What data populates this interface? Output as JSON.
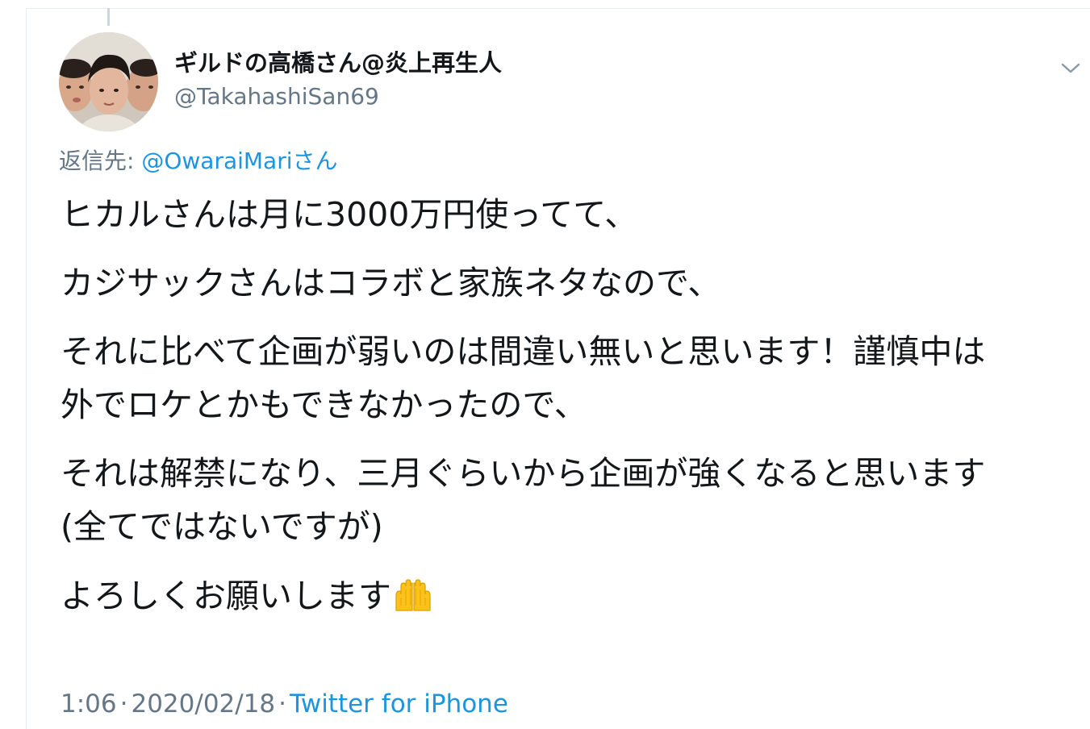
{
  "tweet": {
    "author": {
      "display_name": "ギルドの高橋さん@炎上再生人",
      "handle": "@TakahashiSan69"
    },
    "reply": {
      "prefix": "返信先: ",
      "mention": "@OwaraiMariさん"
    },
    "lines": [
      "ヒカルさんは月に3000万円使ってて、",
      "カジサックさんはコラボと家族ネタなので、",
      "それに比べて企画が弱いのは間違い無いと思います！謹慎中は",
      "外でロケとかもできなかったので、",
      "それは解禁になり、三月ぐらいから企画が強くなると思います",
      "(全てではないですが)",
      "よろしくお願いします"
    ],
    "closing_emoji": "palms-up-together-emoji",
    "meta": {
      "time": "1:06",
      "separator": "·",
      "date": "2020/02/18",
      "source": "Twitter for iPhone"
    },
    "icons": {
      "caret": "chevron-down-icon"
    },
    "colors": {
      "link": "#1b95e0",
      "muted": "#657786",
      "text": "#14171a",
      "border": "#e6ecf0"
    }
  }
}
